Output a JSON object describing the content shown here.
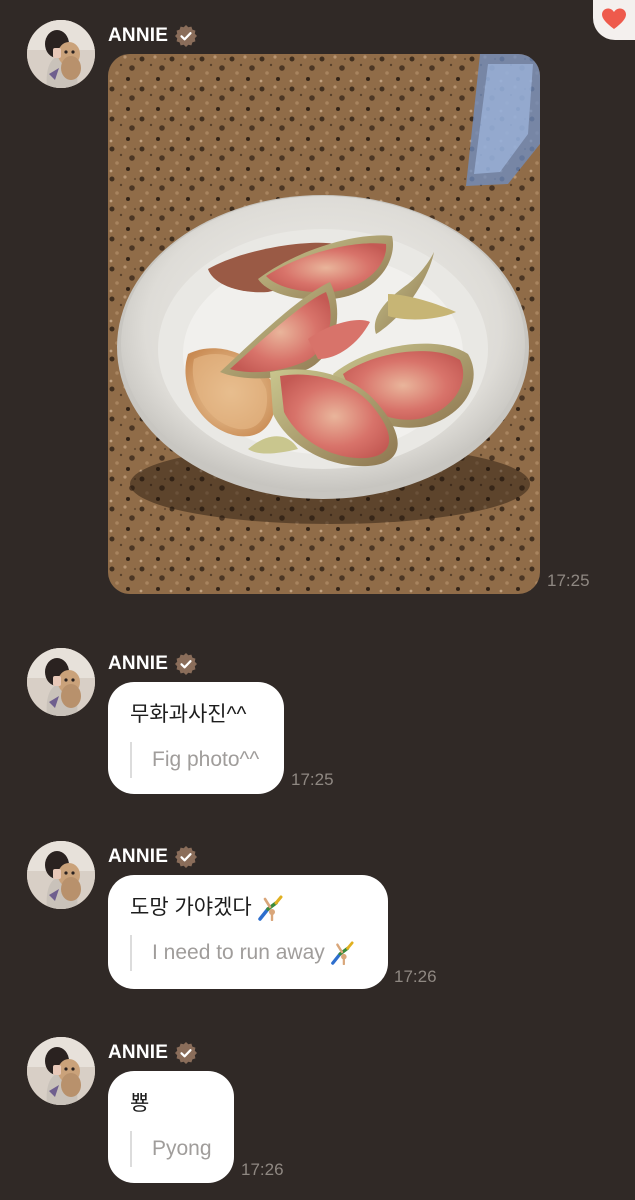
{
  "colors": {
    "background": "#302926",
    "bubble": "#ffffff",
    "timestamp": "#8f8882",
    "translation_text": "#a09d9b",
    "verified_badge": "#8a6d5a",
    "heart": "#ee5a4c"
  },
  "icons": {
    "heart": "heart-icon",
    "verified": "verified-badge-icon",
    "gymnast": "gymnast-emoji-icon"
  },
  "messages": [
    {
      "sender": "ANNIE",
      "type": "image",
      "image_description": "bowl of sliced figs",
      "time": "17:25"
    },
    {
      "sender": "ANNIE",
      "type": "text",
      "text": "무화과사진^^",
      "translation": "Fig photo^^",
      "time": "17:25"
    },
    {
      "sender": "ANNIE",
      "type": "text",
      "text": "도망 가야겠다",
      "translation": "I need to run away",
      "time": "17:26"
    },
    {
      "sender": "ANNIE",
      "type": "text",
      "text": "뿅",
      "translation": "Pyong",
      "time": "17:26"
    }
  ]
}
